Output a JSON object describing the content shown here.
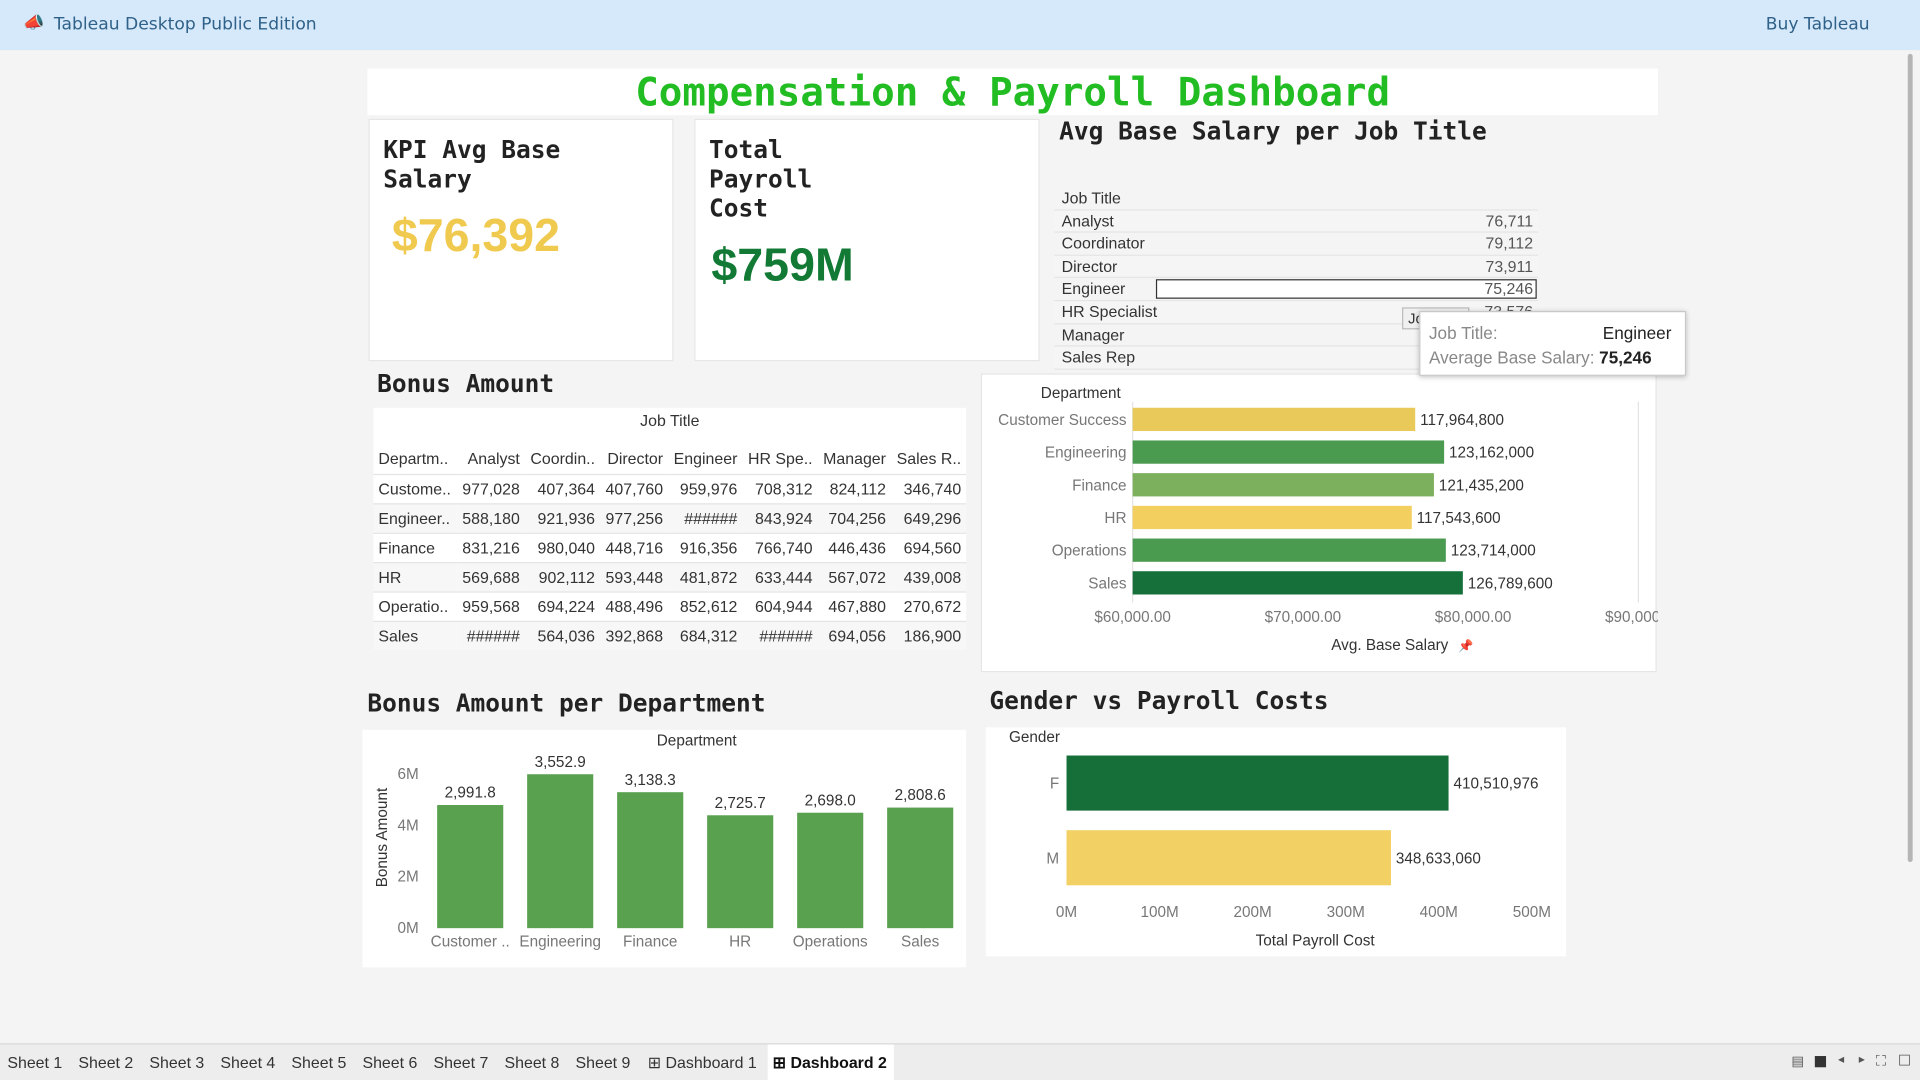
{
  "app": {
    "edition_label": "Tableau Desktop Public Edition",
    "buy_label": "Buy Tableau"
  },
  "dashboard": {
    "title": "Compensation & Payroll Dashboard"
  },
  "kpi_salary": {
    "heading_line1": "KPI Avg Base",
    "heading_line2": "Salary",
    "value": "$76,392",
    "color": "#f0c94f"
  },
  "kpi_payroll": {
    "heading_line1": "Total",
    "heading_line2": "Payroll",
    "heading_line3": "Cost",
    "value": "$759M",
    "color": "#127a35"
  },
  "job_title_table": {
    "heading": "Avg Base Salary per Job Title",
    "column_header": "Job Title",
    "rows": [
      {
        "label": "Analyst",
        "value": "76,711"
      },
      {
        "label": "Coordinator",
        "value": "79,112"
      },
      {
        "label": "Director",
        "value": "73,911"
      },
      {
        "label": "Engineer",
        "value": "75,246"
      },
      {
        "label": "HR Specialist",
        "value": "73,576"
      },
      {
        "label": "Manager",
        "value": ""
      },
      {
        "label": "Sales Rep",
        "value": ""
      }
    ],
    "selected_row": "Engineer"
  },
  "tooltip": {
    "pill_label": "Job Title",
    "k1": "Job Title:",
    "v1": "Engineer",
    "k2": "Average Base Salary:",
    "v2": "75,246"
  },
  "bonus_table": {
    "heading": "Bonus Amount",
    "column_group": "Job Title",
    "columns": [
      "Departm..",
      "Analyst",
      "Coordin..",
      "Director",
      "Engineer",
      "HR Spe..",
      "Manager",
      "Sales R.."
    ],
    "rows": [
      [
        "Custome..",
        "977,028",
        "407,364",
        "407,760",
        "959,976",
        "708,312",
        "824,112",
        "346,740"
      ],
      [
        "Engineer..",
        "588,180",
        "921,936",
        "977,256",
        "######",
        "843,924",
        "704,256",
        "649,296"
      ],
      [
        "Finance",
        "831,216",
        "980,040",
        "448,716",
        "916,356",
        "766,740",
        "446,436",
        "694,560"
      ],
      [
        "HR",
        "569,688",
        "902,112",
        "593,448",
        "481,872",
        "633,444",
        "567,072",
        "439,008"
      ],
      [
        "Operatio..",
        "959,568",
        "694,224",
        "488,496",
        "852,612",
        "604,944",
        "467,880",
        "270,672"
      ],
      [
        "Sales",
        "######",
        "564,036",
        "392,868",
        "684,312",
        "######",
        "694,056",
        "186,900"
      ]
    ]
  },
  "sheets": {
    "s1": "Sheet 1",
    "s2": "Sheet 2",
    "s3": "Sheet 3",
    "s4": "Sheet 4",
    "s5": "Sheet 5",
    "s6": "Sheet 6",
    "s7": "Sheet 7",
    "s8": "Sheet 8",
    "s9": "Sheet 9",
    "d1": "Dashboard 1",
    "d2": "Dashboard 2"
  },
  "chart_data": [
    {
      "id": "dept_salary",
      "type": "bar",
      "orientation": "horizontal",
      "row_header": "Department",
      "categories": [
        "Customer Success",
        "Engineering",
        "Finance",
        "HR",
        "Operations",
        "Sales"
      ],
      "values": [
        117964800,
        123162000,
        121435200,
        117543600,
        123714000,
        126789600
      ],
      "data_labels": [
        "117,964,800",
        "123,162,000",
        "121,435,200",
        "117,543,600",
        "123,714,000",
        "126,789,600"
      ],
      "axis_values": [
        76600,
        78300,
        77700,
        76400,
        78400,
        79400
      ],
      "xlim": [
        60000,
        90000
      ],
      "xticks": [
        "$60,000.00",
        "$70,000.00",
        "$80,000.00",
        "$90,000.00"
      ],
      "tick_values": [
        60000,
        70000,
        80000,
        90000
      ],
      "xlabel": "Avg. Base Salary",
      "colors": [
        "#e8c95a",
        "#4a9a50",
        "#7cb05c",
        "#f3cf5f",
        "#4a9a50",
        "#15703a"
      ]
    },
    {
      "id": "bonus_dept",
      "type": "bar",
      "heading": "Bonus Amount per Department",
      "column_header": "Department",
      "categories": [
        "Customer ..",
        "Engineering",
        "Finance",
        "HR",
        "Operations",
        "Sales"
      ],
      "values": [
        2991.8,
        3552.9,
        3138.3,
        2725.7,
        2698.0,
        2808.6
      ],
      "data_labels": [
        "2,991.8",
        "3,552.9",
        "3,138.3",
        "2,725.7",
        "2,698.0",
        "2,808.6"
      ],
      "bar_heights_M": [
        4.8,
        6.0,
        5.3,
        4.4,
        4.5,
        4.7
      ],
      "yticks": [
        "0M",
        "2M",
        "4M",
        "6M"
      ],
      "tick_values": [
        0,
        2,
        4,
        6
      ],
      "ylim": [
        0,
        6.3
      ],
      "ylabel": "Bonus Amount",
      "color": "#59a14f"
    },
    {
      "id": "gender_payroll",
      "type": "bar",
      "orientation": "horizontal",
      "heading": "Gender vs Payroll Costs",
      "row_header": "Gender",
      "categories": [
        "F",
        "M"
      ],
      "values": [
        410510976,
        348633060
      ],
      "data_labels": [
        "410,510,976",
        "348,633,060"
      ],
      "xlim": [
        0,
        500000000
      ],
      "xticks": [
        "0M",
        "100M",
        "200M",
        "300M",
        "400M",
        "500M"
      ],
      "tick_values": [
        0,
        100000000,
        200000000,
        300000000,
        400000000,
        500000000
      ],
      "xlabel": "Total Payroll Cost",
      "colors": [
        "#166f38",
        "#f3d063"
      ]
    }
  ]
}
